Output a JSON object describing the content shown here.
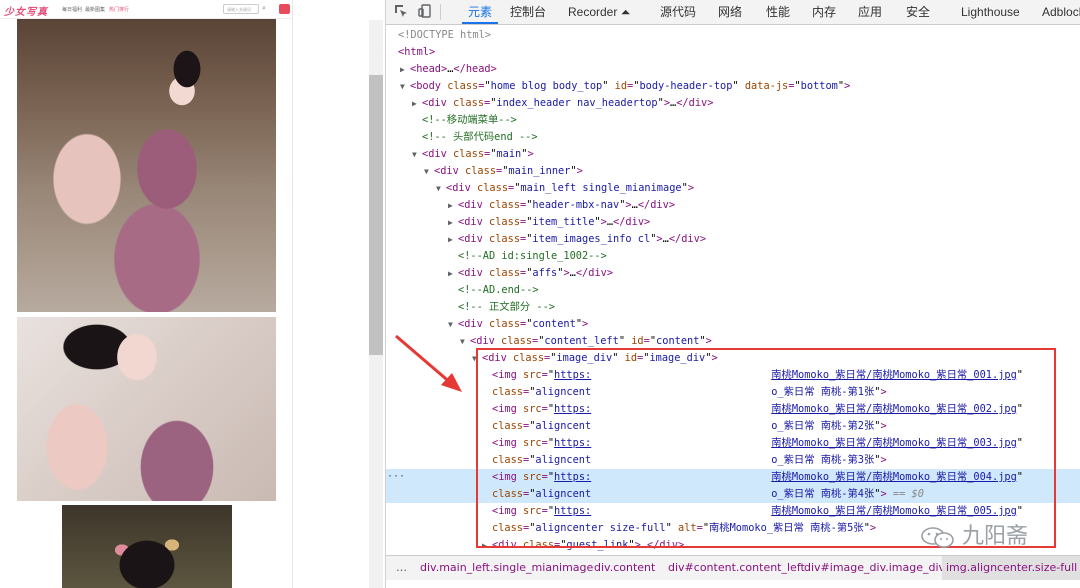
{
  "website": {
    "logo": "少女写真",
    "nav": [
      "每日福利",
      "最新图集",
      "热门排行"
    ],
    "search_placeholder": "请输入关键词",
    "search_icon": "search-icon"
  },
  "devtools": {
    "toolbar_icons": [
      "inspect-icon",
      "device-toggle-icon"
    ],
    "tabs": [
      {
        "label": "元素",
        "active": true
      },
      {
        "label": "控制台"
      },
      {
        "label": "Recorder ⏶"
      },
      {
        "label": "源代码"
      },
      {
        "label": "网络"
      },
      {
        "label": "性能"
      },
      {
        "label": "内存"
      },
      {
        "label": "应用"
      },
      {
        "label": "安全"
      },
      {
        "label": "Lighthouse"
      },
      {
        "label": "Adblock"
      }
    ],
    "dom": {
      "doctype": "<!DOCTYPE html>",
      "html": "html",
      "head": "head",
      "body_tag": "body",
      "body_attrs": {
        "class": "home blog body_top",
        "id": "body-header-top",
        "data-js": "bottom"
      },
      "index_header_class": "index_header nav_headertop",
      "comment_mobile_menu": "<!--移动端菜单-->",
      "comment_header_end": "<!-- 头部代码end -->",
      "main_class": "main",
      "main_inner_class": "main_inner",
      "main_left_class": "main_left single_mianimage",
      "header_nav_class": "header-mbx-nav",
      "item_title_class": "item_title",
      "item_images_class": "item_images_info cl",
      "comment_ad": "<!--AD id:single_1002-->",
      "affs_class": "affs",
      "comment_ad_end": "<!--AD.end-->",
      "comment_body": "<!-- 正文部分 -->",
      "content_class": "content",
      "content_left_class": "content_left",
      "content_left_id": "content",
      "image_div_class": "image_div",
      "image_div_id": "image_div",
      "images": [
        {
          "src_prefix": "https:",
          "src_file": "南桃Momoko_紫日常/南桃Momoko_紫日常_001.jpg",
          "class": "aligncent",
          "alt_tail": "o_紫日常 南桃-第1张"
        },
        {
          "src_prefix": "https:",
          "src_file": "南桃Momoko_紫日常/南桃Momoko_紫日常_002.jpg",
          "class": "aligncent",
          "alt_tail": "o_紫日常 南桃-第2张"
        },
        {
          "src_prefix": "https:",
          "src_file": "南桃Momoko_紫日常/南桃Momoko_紫日常_003.jpg",
          "class": "aligncent",
          "alt_tail": "o_紫日常 南桃-第3张"
        },
        {
          "src_prefix": "https:",
          "src_file": "南桃Momoko_紫日常/南桃Momoko_紫日常_004.jpg",
          "class": "aligncent",
          "alt_tail": "o_紫日常 南桃-第4张",
          "selected": true
        },
        {
          "src_prefix": "https:",
          "src_file": "南桃Momoko_紫日常/南桃Momoko_紫日常_005.jpg",
          "class": "aligncenter size-full",
          "alt": "南桃Momoko_紫日常 南桃-第5张"
        }
      ],
      "guest_link_class": "guest_link",
      "selected_marker": "== $0",
      "ellipsis": "…"
    },
    "breadcrumbs": [
      "div.main_left.single_mianimage",
      "div.content",
      "div#content.content_left",
      "div#image_div.image_div",
      "img.aligncenter.size-full"
    ]
  },
  "watermark": {
    "text": "九阳斋"
  },
  "colors": {
    "highlight_box": "#e53935",
    "selected_row": "#cfe8fc",
    "active_tab": "#1a73e8"
  }
}
